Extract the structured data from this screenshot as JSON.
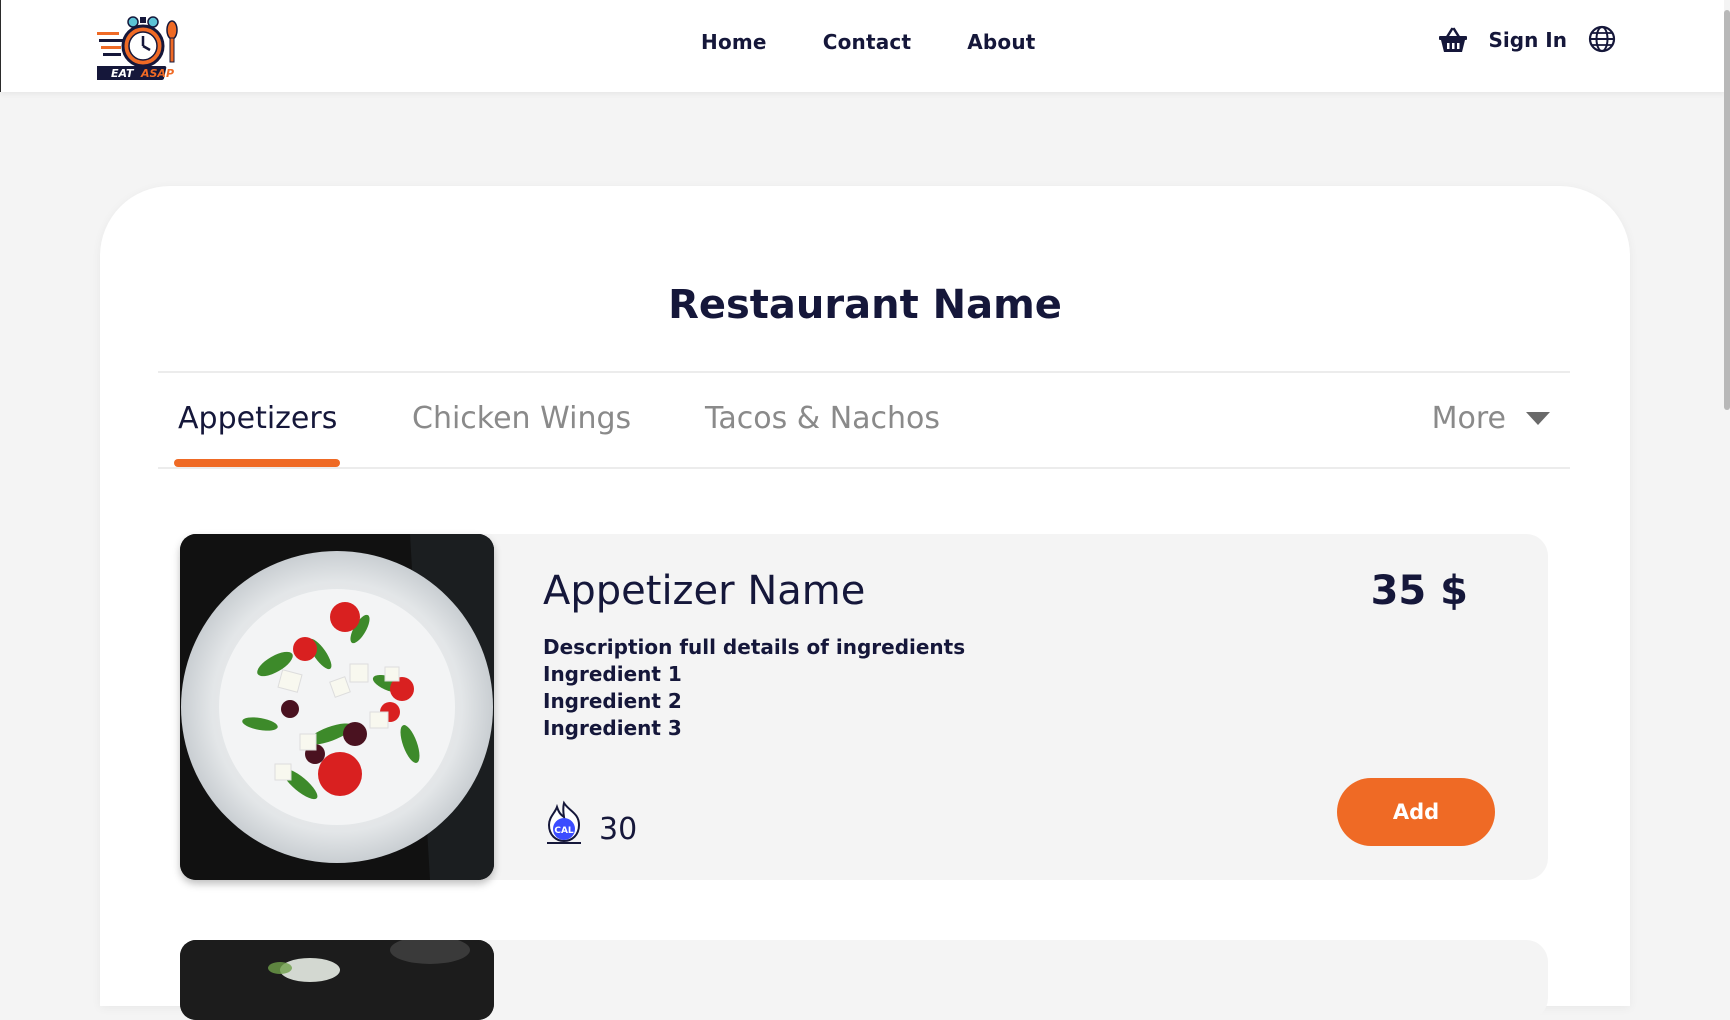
{
  "header": {
    "logo_text": "EAT ASAP",
    "nav": {
      "home": "Home",
      "contact": "Contact",
      "about": "About"
    },
    "sign_in": "Sign In",
    "icons": {
      "cart": "basket-icon",
      "language": "globe-icon"
    }
  },
  "restaurant": {
    "name": "Restaurant Name"
  },
  "tabs": {
    "items": [
      {
        "label": "Appetizers",
        "active": true
      },
      {
        "label": "Chicken Wings",
        "active": false
      },
      {
        "label": "Tacos & Nachos",
        "active": false
      }
    ],
    "more_label": "More"
  },
  "menu_items": [
    {
      "name": "Appetizer Name",
      "price": "35 $",
      "description": "Description full details of ingredients",
      "ingredients": [
        "Ingredient 1",
        "Ingredient 2",
        "Ingredient 3"
      ],
      "calorie_badge": "CAL",
      "calories": "30",
      "add_label": "Add"
    }
  ],
  "colors": {
    "accent": "#ef6a25",
    "text_dark": "#15173a",
    "text_muted": "#8a8a8a",
    "page_bg": "#f4f4f4",
    "calorie_badge": "#3b4cff"
  }
}
